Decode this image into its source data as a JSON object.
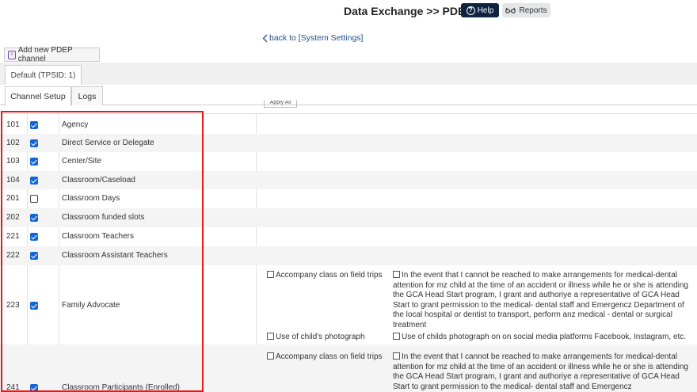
{
  "header": {
    "title": "Data Exchange >> PDEP",
    "help_label": "Help",
    "reports_label": "Reports"
  },
  "back_link": "back to [System Settings]",
  "add_channel_label": "Add new PDEP channel",
  "channel_tab": "Default (TPSID: 1)",
  "tabs": [
    "Channel Setup",
    "Logs"
  ],
  "apply_all_label": "Apply All",
  "rows": [
    {
      "code": "101",
      "checked": true,
      "label": "Agency"
    },
    {
      "code": "102",
      "checked": true,
      "label": "Direct Service or Delegate"
    },
    {
      "code": "103",
      "checked": true,
      "label": "Center/Site"
    },
    {
      "code": "104",
      "checked": true,
      "label": "Classroom/Caseload"
    },
    {
      "code": "201",
      "checked": false,
      "label": "Classroom Days"
    },
    {
      "code": "202",
      "checked": true,
      "label": "Classroom funded slots"
    },
    {
      "code": "221",
      "checked": true,
      "label": "Classroom Teachers"
    },
    {
      "code": "222",
      "checked": true,
      "label": "Classroom Assistant Teachers"
    },
    {
      "code": "223",
      "checked": true,
      "label": "Family Advocate"
    },
    {
      "code": "241",
      "checked": true,
      "label": "Classroom Participants (Enrolled)"
    }
  ],
  "permissions": {
    "field_trips": "Accompany class on field trips",
    "medical_consent": "In the event that I cannot be reached to make arrangements for medical-dental attention for mz child at the time of an accident or illness while he or she is attending the GCA Head Start program, I grant and authoriye a representative of GCA Head Start to grant permission to the medical- dental staff and Emergencz Department of the local hospital or dentist to transport, perform anz medical - dental or surgical treatment",
    "photo": "Use of child's photograph",
    "social_media": "Use of childs photograph on on social media platforms Facebook, Instagram, etc.",
    "medical_consent_partial": "In the event that I cannot be reached to make arrangements for medical-dental attention for mz child at the time of an accident or illness while he or she is attending the GCA Head Start program, I grant and authoriye a representative of GCA Head Start to grant permission to the medical- dental staff and Emergencz"
  },
  "colors": {
    "help_bg": "#0d2340",
    "link": "#1f4f8f",
    "checkbox": "#1565d8",
    "highlight": "#e01b1b"
  }
}
